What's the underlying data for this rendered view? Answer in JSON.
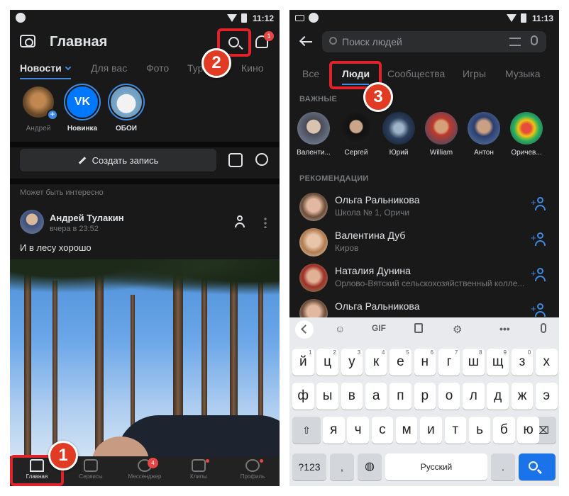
{
  "left": {
    "status": {
      "time": "11:12"
    },
    "header": {
      "title": "Главная",
      "bell_badge": "1"
    },
    "tabs": [
      "Новости",
      "Для вас",
      "Фото",
      "Тури",
      "Кино"
    ],
    "stories": [
      {
        "label": "Андрей"
      },
      {
        "label": "Новинка",
        "logo": "VK"
      },
      {
        "label": "ОБОИ"
      }
    ],
    "create_post": "Создать запись",
    "suggest_label": "Может быть интересно",
    "post": {
      "author": "Андрей Тулакин",
      "time": "вчера в 23:52",
      "text": "И в лесу хорошо"
    },
    "nav": [
      {
        "label": "Главная"
      },
      {
        "label": "Сервисы"
      },
      {
        "label": "Мессенджер",
        "badge": "4"
      },
      {
        "label": "Клипы"
      },
      {
        "label": "Профиль"
      }
    ]
  },
  "right": {
    "status": {
      "time": "11:13"
    },
    "search": {
      "placeholder": "Поиск людей"
    },
    "tabs": [
      "Все",
      "Люди",
      "Сообщества",
      "Игры",
      "Музыка"
    ],
    "important_title": "ВАЖНЫЕ",
    "important": [
      "Валенти...",
      "Сергей",
      "Юрий",
      "William",
      "Антон",
      "Оричев..."
    ],
    "recommend_title": "РЕКОМЕНДАЦИИ",
    "recommendations": [
      {
        "name": "Ольга Ральникова",
        "sub": "Школа № 1, Оричи"
      },
      {
        "name": "Валентина Дуб",
        "sub": "Киров"
      },
      {
        "name": "Наталия Дунина",
        "sub": "Орлово-Вятский сельскохозяйственный колле..."
      },
      {
        "name": "Ольга Ральникова",
        "sub": ""
      }
    ],
    "keyboard": {
      "toolbar_gif": "GIF",
      "row1": [
        "й",
        "ц",
        "у",
        "к",
        "е",
        "н",
        "г",
        "ш",
        "щ",
        "з",
        "х"
      ],
      "row1_hints": [
        "1",
        "2",
        "3",
        "4",
        "5",
        "6",
        "7",
        "8",
        "9",
        "0",
        ""
      ],
      "row2": [
        "ф",
        "ы",
        "в",
        "а",
        "п",
        "р",
        "о",
        "л",
        "д",
        "ж",
        "э"
      ],
      "row3": [
        "я",
        "ч",
        "с",
        "м",
        "и",
        "т",
        "ь",
        "б",
        "ю"
      ],
      "symbols": "?123",
      "comma": ",",
      "space": "Русский",
      "period": "."
    }
  },
  "steps": [
    "1",
    "2",
    "3"
  ],
  "colors": {
    "accent": "#3f8ae0",
    "highlight": "#e0222b",
    "step_badge": "#e23b24",
    "background": "#19191a"
  }
}
